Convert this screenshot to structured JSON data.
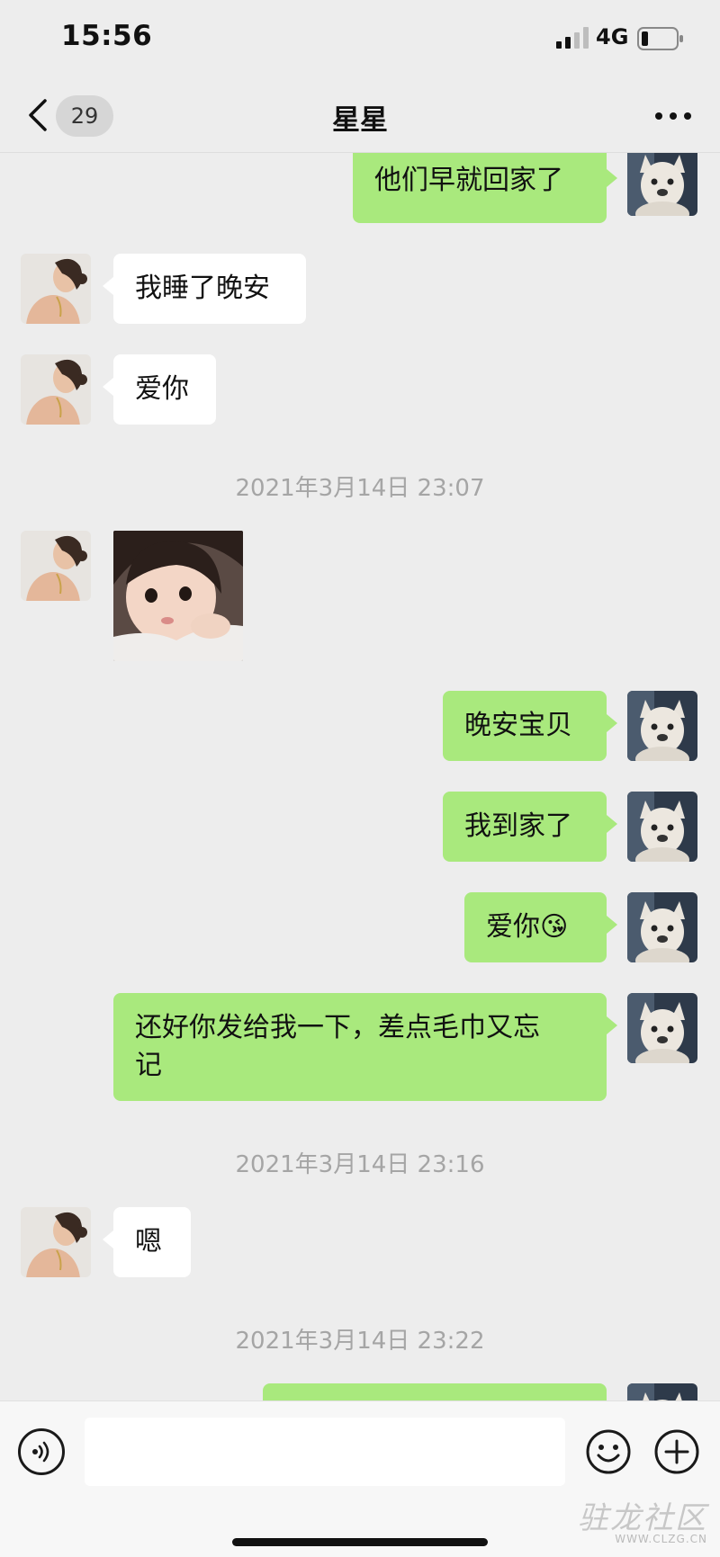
{
  "status_bar": {
    "time": "15:56",
    "network": "4G",
    "signal_icon": "signal-bars-icon",
    "battery_icon": "battery-low-icon"
  },
  "nav": {
    "back_icon": "chevron-left-icon",
    "unread_count": "29",
    "title": "星星",
    "more_icon": "ellipsis-icon"
  },
  "colors": {
    "background": "#EDEDED",
    "outgoing_bubble": "#A9E97D",
    "incoming_bubble": "#FFFFFF",
    "timestamp": "#A5A5A5"
  },
  "messages": [
    {
      "from": "me",
      "text": "他们早就回家了"
    },
    {
      "from": "contact",
      "text": "我睡了晚安"
    },
    {
      "from": "contact",
      "text": "爱你"
    },
    {
      "type": "timestamp",
      "text": "2021年3月14日 23:07"
    },
    {
      "from": "contact",
      "type": "image",
      "content": "child-photo"
    },
    {
      "from": "me",
      "text": "晚安宝贝"
    },
    {
      "from": "me",
      "text": "我到家了"
    },
    {
      "from": "me",
      "text": "爱你",
      "emoji": "😘"
    },
    {
      "from": "me",
      "text_lines": [
        "还好你发给我一下，差点毛巾又忘",
        "记"
      ]
    },
    {
      "type": "timestamp",
      "text": "2021年3月14日 23:16"
    },
    {
      "from": "contact",
      "text": "嗯"
    },
    {
      "type": "timestamp",
      "text": "2021年3月14日 23:22"
    },
    {
      "from": "me",
      "text": ""
    }
  ],
  "input_bar": {
    "voice_icon": "voice-icon",
    "input_value": "",
    "emoji_icon": "smiley-icon",
    "plus_icon": "plus-circle-icon"
  },
  "watermark": {
    "logo_text": "驻龙社区",
    "sub_text": "WWW.CLZG.CN"
  }
}
